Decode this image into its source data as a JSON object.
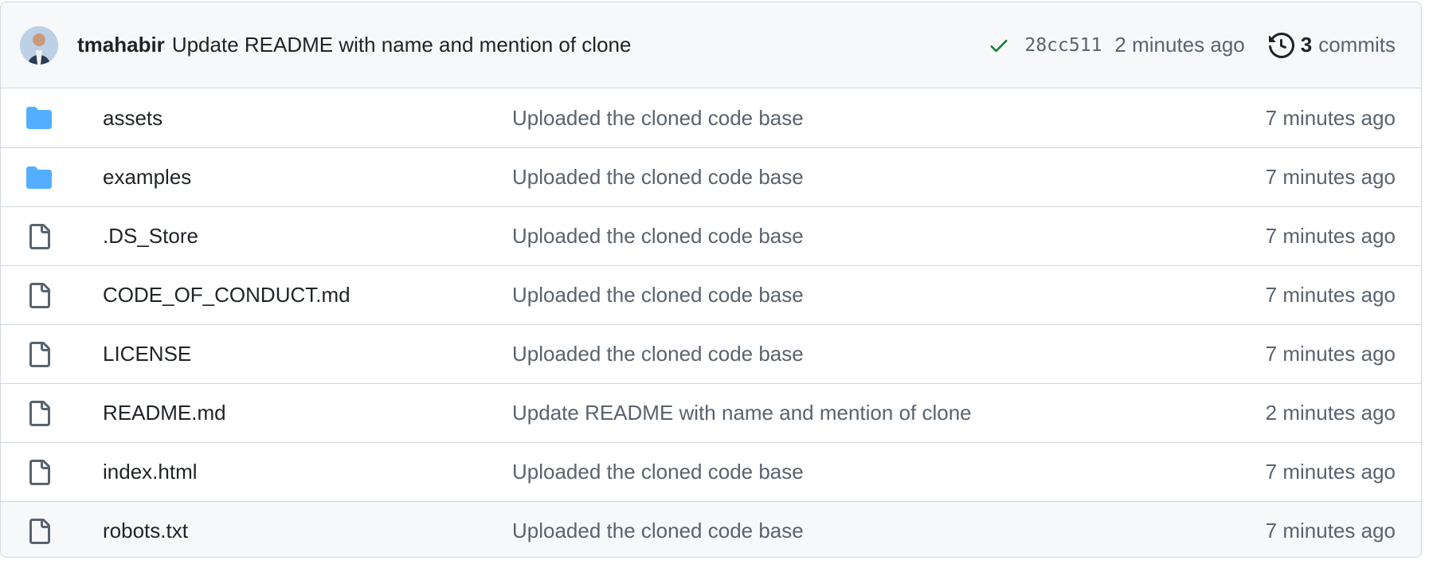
{
  "latest_commit": {
    "author": "tmahabir",
    "message": "Update README with name and mention of clone",
    "status_icon": "check-icon",
    "sha": "28cc511",
    "time": "2 minutes ago",
    "history_icon": "history-icon",
    "commit_count": "3",
    "commits_label": "commits"
  },
  "files": [
    {
      "type": "directory",
      "icon": "folder-icon",
      "name": "assets",
      "message": "Uploaded the cloned code base",
      "time": "7 minutes ago"
    },
    {
      "type": "directory",
      "icon": "folder-icon",
      "name": "examples",
      "message": "Uploaded the cloned code base",
      "time": "7 minutes ago"
    },
    {
      "type": "file",
      "icon": "file-icon",
      "name": ".DS_Store",
      "message": "Uploaded the cloned code base",
      "time": "7 minutes ago"
    },
    {
      "type": "file",
      "icon": "file-icon",
      "name": "CODE_OF_CONDUCT.md",
      "message": "Uploaded the cloned code base",
      "time": "7 minutes ago"
    },
    {
      "type": "file",
      "icon": "file-icon",
      "name": "LICENSE",
      "message": "Uploaded the cloned code base",
      "time": "7 minutes ago"
    },
    {
      "type": "file",
      "icon": "file-icon",
      "name": "README.md",
      "message": "Update README with name and mention of clone",
      "time": "2 minutes ago"
    },
    {
      "type": "file",
      "icon": "file-icon",
      "name": "index.html",
      "message": "Uploaded the cloned code base",
      "time": "7 minutes ago"
    },
    {
      "type": "file",
      "icon": "file-icon",
      "name": "robots.txt",
      "message": "Uploaded the cloned code base",
      "time": "7 minutes ago"
    }
  ],
  "colors": {
    "folder": "#54aeff",
    "file_icon": "#59636e",
    "check": "#1a7f37",
    "header_bg": "#f6f8fa",
    "border": "#d0d7de"
  }
}
